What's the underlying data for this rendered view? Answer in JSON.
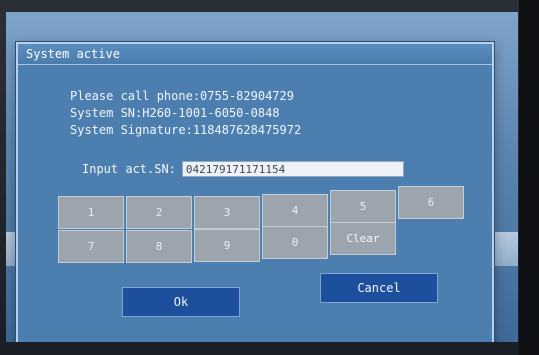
{
  "dialog": {
    "title": "System active",
    "phone_line": "Please call phone:0755-82904729",
    "sn_line": "System SN:H260-1001-6050-0848",
    "signature_line": "System Signature:118487628475972",
    "input_label": "Input act.SN:",
    "input_value": "042179171171154"
  },
  "keypad": {
    "keys": [
      "1",
      "2",
      "3",
      "4",
      "5",
      "6",
      "7",
      "8",
      "9",
      "0",
      "Clear"
    ]
  },
  "buttons": {
    "ok_label": "Ok",
    "cancel_label": "Cancel"
  },
  "colors": {
    "dialog_background": "#4c7fb0",
    "key_background": "#9ca4ad",
    "button_background": "#1e4f9c"
  }
}
